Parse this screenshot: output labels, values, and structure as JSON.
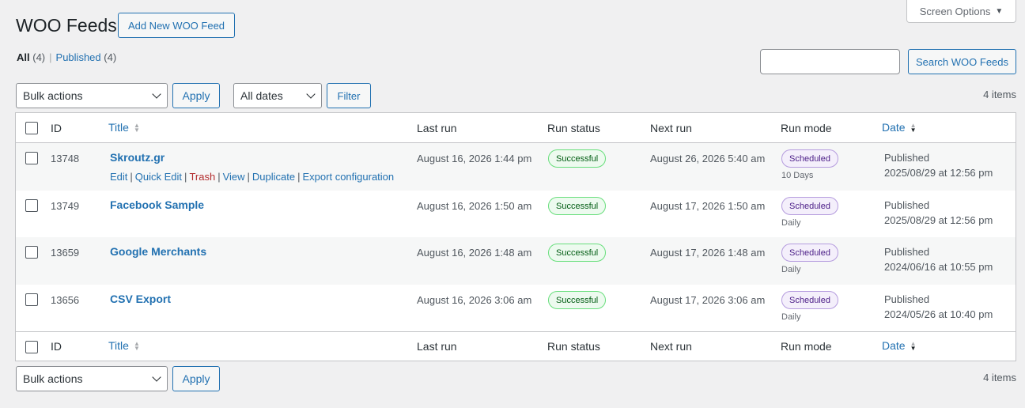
{
  "screen_options": {
    "label": "Screen Options",
    "caret": "▼"
  },
  "page": {
    "title": "WOO Feeds",
    "add_new_label": "Add New WOO Feed"
  },
  "views": {
    "all_label": "All",
    "all_count": "(4)",
    "separator": "|",
    "published_label": "Published",
    "published_count": "(4)"
  },
  "search": {
    "value": "",
    "button_label": "Search WOO Feeds"
  },
  "tablenav_top": {
    "bulk_label": "Bulk actions",
    "apply_label": "Apply",
    "dates_label": "All dates",
    "filter_label": "Filter",
    "items": "4 items"
  },
  "tablenav_bottom": {
    "bulk_label": "Bulk actions",
    "apply_label": "Apply",
    "items": "4 items"
  },
  "columns": {
    "id": "ID",
    "title": "Title",
    "last_run": "Last run",
    "run_status": "Run status",
    "next_run": "Next run",
    "run_mode": "Run mode",
    "date": "Date"
  },
  "row_actions": [
    "Edit",
    "Quick Edit",
    "Trash",
    "View",
    "Duplicate",
    "Export configuration"
  ],
  "rows": [
    {
      "id": "13748",
      "title": "Skroutz.gr",
      "last_run": "August 16, 2026 1:44 pm",
      "status": "Successful",
      "next_run": "August 26, 2026 5:40 am",
      "mode": "Scheduled",
      "mode_sub": "10 Days",
      "date_status": "Published",
      "date": "2025/08/29 at 12:56 pm"
    },
    {
      "id": "13749",
      "title": "Facebook Sample",
      "last_run": "August 16, 2026 1:50 am",
      "status": "Successful",
      "next_run": "August 17, 2026 1:50 am",
      "mode": "Scheduled",
      "mode_sub": "Daily",
      "date_status": "Published",
      "date": "2025/08/29 at 12:56 pm"
    },
    {
      "id": "13659",
      "title": "Google Merchants",
      "last_run": "August 16, 2026 1:48 am",
      "status": "Successful",
      "next_run": "August 17, 2026 1:48 am",
      "mode": "Scheduled",
      "mode_sub": "Daily",
      "date_status": "Published",
      "date": "2024/06/16 at 10:55 pm"
    },
    {
      "id": "13656",
      "title": "CSV Export",
      "last_run": "August 16, 2026 3:06 am",
      "status": "Successful",
      "next_run": "August 17, 2026 3:06 am",
      "mode": "Scheduled",
      "mode_sub": "Daily",
      "date_status": "Published",
      "date": "2024/05/26 at 10:40 pm"
    }
  ],
  "colors": {
    "accent": "#2271b1",
    "trash": "#b32d2e",
    "success_bg": "#edfaef",
    "scheduled_bg": "#f4effb"
  },
  "icons": {
    "sort": "sort-arrows-icon",
    "dropdown": "chevron-down-icon"
  }
}
